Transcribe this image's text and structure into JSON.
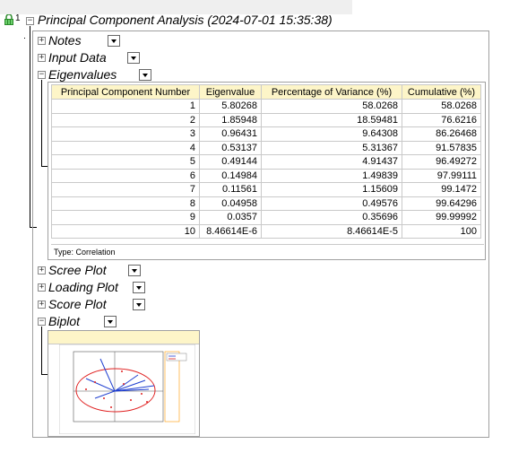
{
  "report": {
    "index": "1",
    "title": "Principal Component Analysis (2024-07-01 15:35:38)",
    "icon": "lock-icon"
  },
  "sections": {
    "notes": "Notes",
    "input_data": "Input Data",
    "eigenvalues": "Eigenvalues",
    "scree_plot": "Scree Plot",
    "loading_plot": "Loading Plot",
    "score_plot": "Score Plot",
    "biplot": "Biplot"
  },
  "eigen_table": {
    "headers": [
      "Principal Component Number",
      "Eigenvalue",
      "Percentage of Variance (%)",
      "Cumulative (%)"
    ],
    "rows": [
      [
        "1",
        "5.80268",
        "58.0268",
        "58.0268"
      ],
      [
        "2",
        "1.85948",
        "18.59481",
        "76.6216"
      ],
      [
        "3",
        "0.96431",
        "9.64308",
        "86.26468"
      ],
      [
        "4",
        "0.53137",
        "5.31367",
        "91.57835"
      ],
      [
        "5",
        "0.49144",
        "4.91437",
        "96.49272"
      ],
      [
        "6",
        "0.14984",
        "1.49839",
        "97.99111"
      ],
      [
        "7",
        "0.11561",
        "1.15609",
        "99.1472"
      ],
      [
        "8",
        "0.04958",
        "0.49576",
        "99.64296"
      ],
      [
        "9",
        "0.0357",
        "0.35696",
        "99.99992"
      ],
      [
        "10",
        "8.46614E-6",
        "8.46614E-5",
        "100"
      ]
    ],
    "note": "Type: Correlation"
  },
  "colors": {
    "header_bg": "#fdf5c8",
    "border": "#a0a0a0",
    "ellipse": "#e02020",
    "vectors": "#1f3fd0"
  }
}
